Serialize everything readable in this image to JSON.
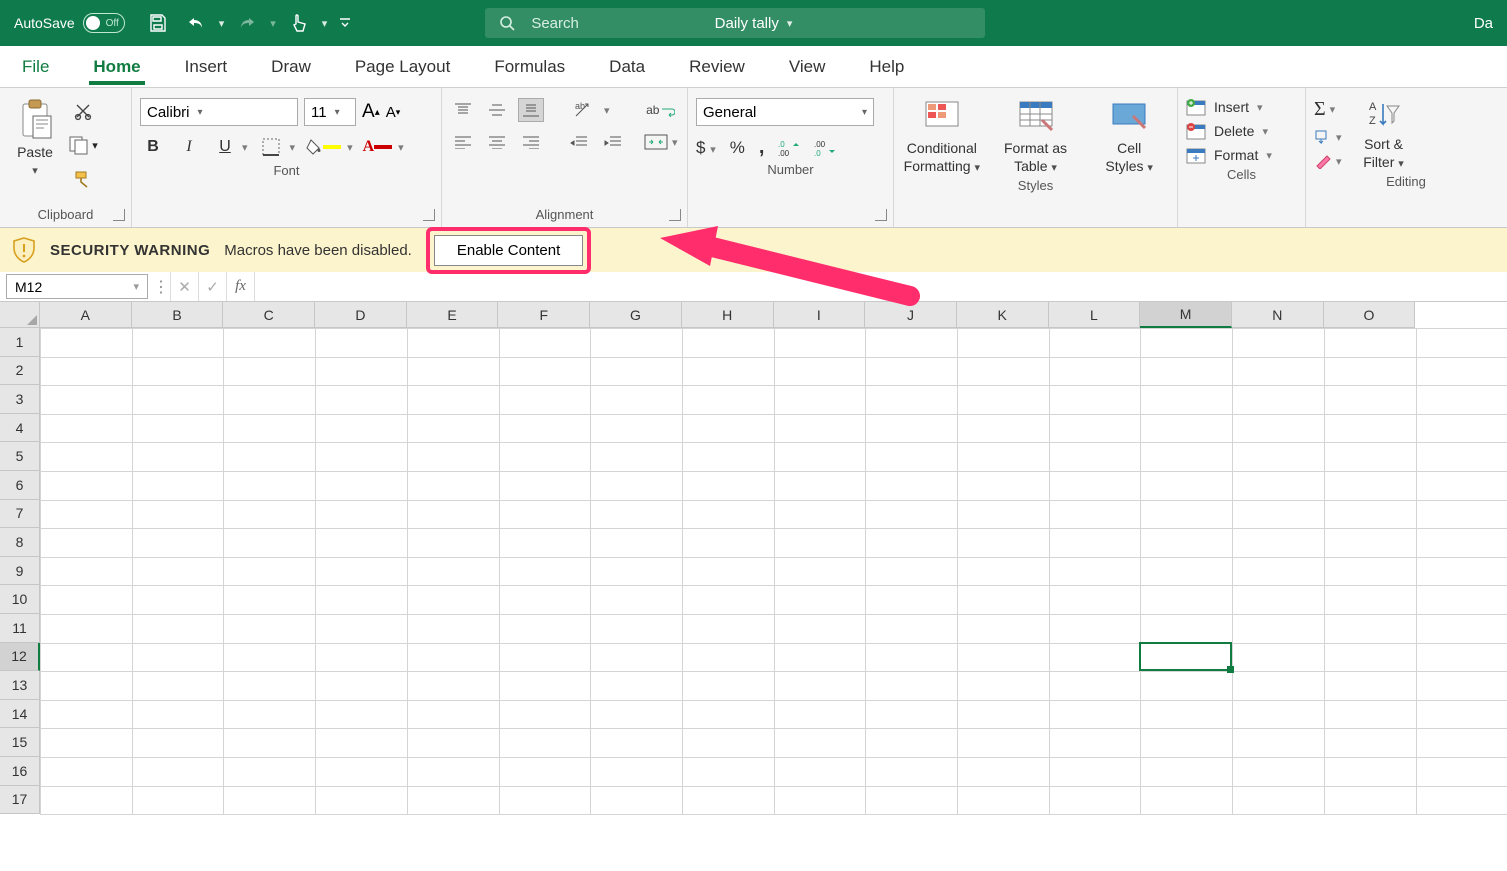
{
  "title_bar": {
    "autosave_label": "AutoSave",
    "autosave_state": "Off",
    "file_name": "Daily tally",
    "search_placeholder": "Search",
    "right_text": "Da"
  },
  "tabs": [
    "File",
    "Home",
    "Insert",
    "Draw",
    "Page Layout",
    "Formulas",
    "Data",
    "Review",
    "View",
    "Help"
  ],
  "active_tab": "Home",
  "ribbon": {
    "clipboard": {
      "label": "Clipboard",
      "paste": "Paste"
    },
    "font": {
      "label": "Font",
      "name": "Calibri",
      "size": "11",
      "bold": "B",
      "italic": "I",
      "underline": "U"
    },
    "alignment": {
      "label": "Alignment",
      "wrap": "ab"
    },
    "number": {
      "label": "Number",
      "format": "General",
      "currency": "$",
      "percent": "%",
      "comma": ","
    },
    "styles": {
      "label": "Styles",
      "cond_l1": "Conditional",
      "cond_l2": "Formatting",
      "table_l1": "Format as",
      "table_l2": "Table",
      "cell_l1": "Cell",
      "cell_l2": "Styles"
    },
    "cells": {
      "label": "Cells",
      "insert": "Insert",
      "delete": "Delete",
      "format": "Format"
    },
    "editing": {
      "label": "Editing",
      "sort_l1": "Sort &",
      "sort_l2": "Filter"
    }
  },
  "warning": {
    "title": "SECURITY WARNING",
    "message": "Macros have been disabled.",
    "button": "Enable Content"
  },
  "formula_bar": {
    "name_box": "M12",
    "fx": "fx",
    "value": ""
  },
  "grid": {
    "columns": [
      "A",
      "B",
      "C",
      "D",
      "E",
      "F",
      "G",
      "H",
      "I",
      "J",
      "K",
      "L",
      "M",
      "N",
      "O"
    ],
    "rows": [
      1,
      2,
      3,
      4,
      5,
      6,
      7,
      8,
      9,
      10,
      11,
      12,
      13,
      14,
      15,
      16,
      17
    ],
    "selected": {
      "col": "M",
      "row": 12,
      "col_index": 12,
      "row_index": 11
    }
  }
}
